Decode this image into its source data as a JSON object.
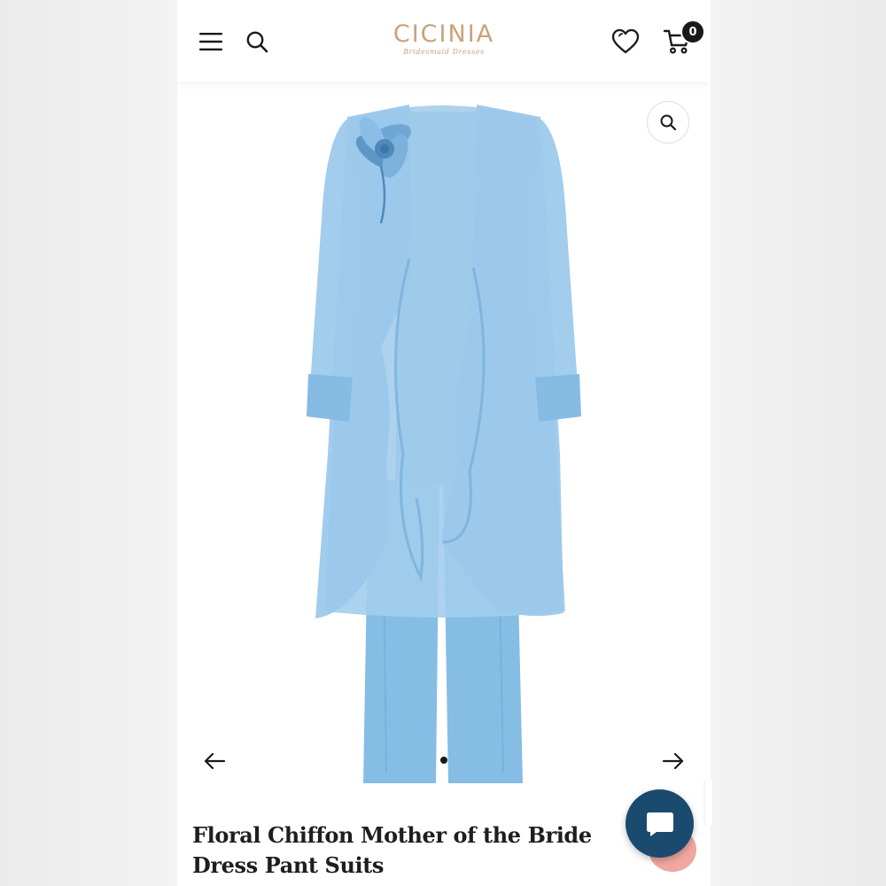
{
  "header": {
    "brand": "CICINIA",
    "tagline": "Bridesmaid Dresses",
    "menu_icon": "hamburger-menu-icon",
    "search_icon": "search-icon",
    "wishlist_icon": "heart-icon",
    "cart_icon": "cart-icon",
    "cart_count": "0",
    "brand_color": "#c9a27a"
  },
  "gallery": {
    "zoom_icon": "magnifier-icon",
    "prev_icon": "arrow-left-icon",
    "next_icon": "arrow-right-icon",
    "current_slide": 1,
    "slide_dots": 1,
    "garment_color": "#8ec1e6"
  },
  "product": {
    "title": "Floral Chiffon Mother of the Bride Dress Pant Suits"
  },
  "chat": {
    "icon": "chat-bubble-icon",
    "button_color": "#1b4a6f"
  }
}
